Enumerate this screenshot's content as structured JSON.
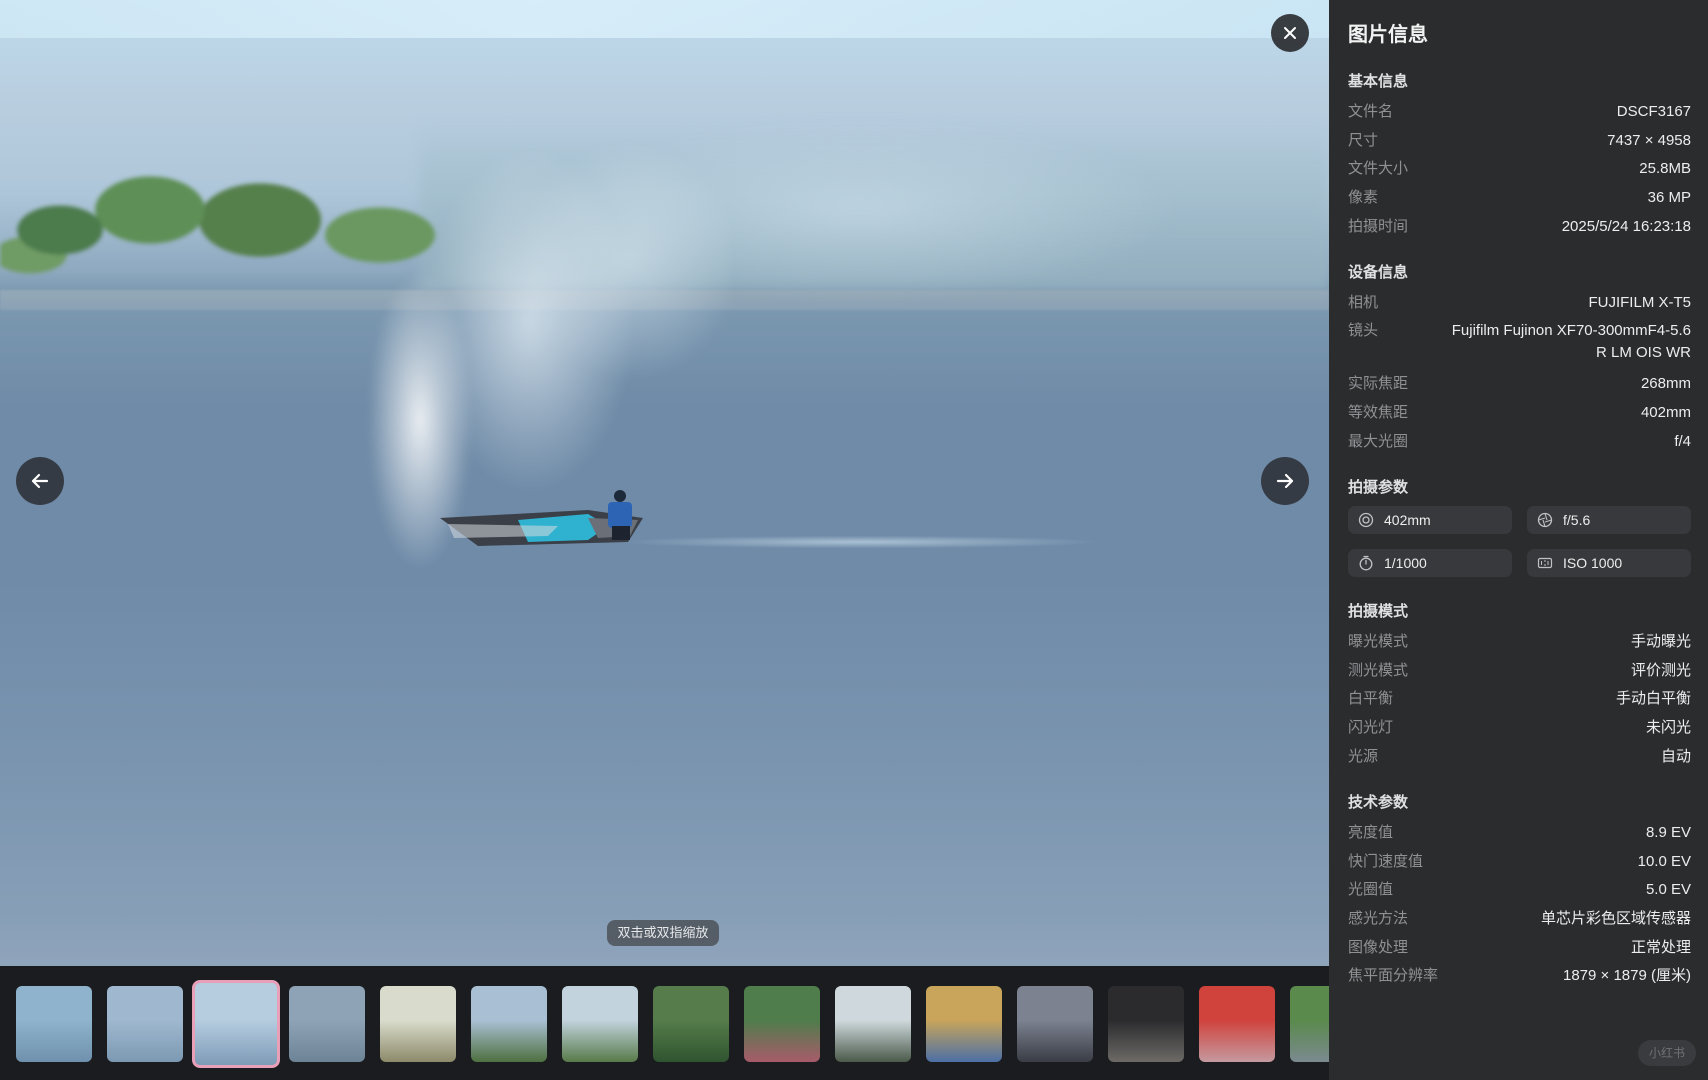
{
  "viewer": {
    "hint": "双击或双指缩放",
    "thumbnails": [
      {
        "id": 1,
        "colors": [
          "#8fb3cc",
          "#6f91ad"
        ]
      },
      {
        "id": 2,
        "colors": [
          "#9fb8cf",
          "#7c99b3"
        ]
      },
      {
        "id": 3,
        "colors": [
          "#b6cde0",
          "#7e9bb7"
        ],
        "active": true
      },
      {
        "id": 4,
        "colors": [
          "#8ea4b6",
          "#6d8396"
        ]
      },
      {
        "id": 5,
        "colors": [
          "#d9dccc",
          "#8d8a6a"
        ]
      },
      {
        "id": 6,
        "colors": [
          "#a9c0d4",
          "#4e7040"
        ]
      },
      {
        "id": 7,
        "colors": [
          "#c2d3de",
          "#577a49"
        ]
      },
      {
        "id": 8,
        "colors": [
          "#557c4a",
          "#2f5430"
        ]
      },
      {
        "id": 9,
        "colors": [
          "#4f7d4b",
          "#a85b6a"
        ]
      },
      {
        "id": 10,
        "colors": [
          "#cfd9dd",
          "#4b5a4a"
        ]
      },
      {
        "id": 11,
        "colors": [
          "#c8a55a",
          "#4b6fa6"
        ]
      },
      {
        "id": 12,
        "colors": [
          "#7c8290",
          "#3a3d45"
        ]
      },
      {
        "id": 13,
        "colors": [
          "#2b2b2e",
          "#6d6a66"
        ]
      },
      {
        "id": 14,
        "colors": [
          "#d0423c",
          "#c59aa0"
        ]
      },
      {
        "id": 15,
        "colors": [
          "#5a8a4c",
          "#7b8a90"
        ]
      }
    ]
  },
  "panel": {
    "title": "图片信息",
    "basic": {
      "title": "基本信息",
      "rows": [
        {
          "k": "文件名",
          "v": "DSCF3167"
        },
        {
          "k": "尺寸",
          "v": "7437 × 4958"
        },
        {
          "k": "文件大小",
          "v": "25.8MB"
        },
        {
          "k": "像素",
          "v": "36 MP"
        },
        {
          "k": "拍摄时间",
          "v": "2025/5/24 16:23:18"
        }
      ]
    },
    "device": {
      "title": "设备信息",
      "camera_k": "相机",
      "camera_v": "FUJIFILM X-T5",
      "lens_k": "镜头",
      "lens_v1": "Fujifilm Fujinon XF70-300mmF4-5.6",
      "lens_v2": "R LM OIS WR",
      "rows": [
        {
          "k": "实际焦距",
          "v": "268mm"
        },
        {
          "k": "等效焦距",
          "v": "402mm"
        },
        {
          "k": "最大光圈",
          "v": "f/4"
        }
      ]
    },
    "params": {
      "title": "拍摄参数",
      "focal": "402mm",
      "aperture": "f/5.6",
      "shutter": "1/1000",
      "iso": "ISO 1000"
    },
    "mode": {
      "title": "拍摄模式",
      "rows": [
        {
          "k": "曝光模式",
          "v": "手动曝光"
        },
        {
          "k": "测光模式",
          "v": "评价测光"
        },
        {
          "k": "白平衡",
          "v": "手动白平衡"
        },
        {
          "k": "闪光灯",
          "v": "未闪光"
        },
        {
          "k": "光源",
          "v": "自动"
        }
      ]
    },
    "tech": {
      "title": "技术参数",
      "rows": [
        {
          "k": "亮度值",
          "v": "8.9 EV"
        },
        {
          "k": "快门速度值",
          "v": "10.0 EV"
        },
        {
          "k": "光圈值",
          "v": "5.0 EV"
        },
        {
          "k": "感光方法",
          "v": "单芯片彩色区域传感器"
        },
        {
          "k": "图像处理",
          "v": "正常处理"
        },
        {
          "k": "焦平面分辨率",
          "v": "1879 × 1879 (厘米)"
        }
      ]
    }
  },
  "watermark": "小红书"
}
